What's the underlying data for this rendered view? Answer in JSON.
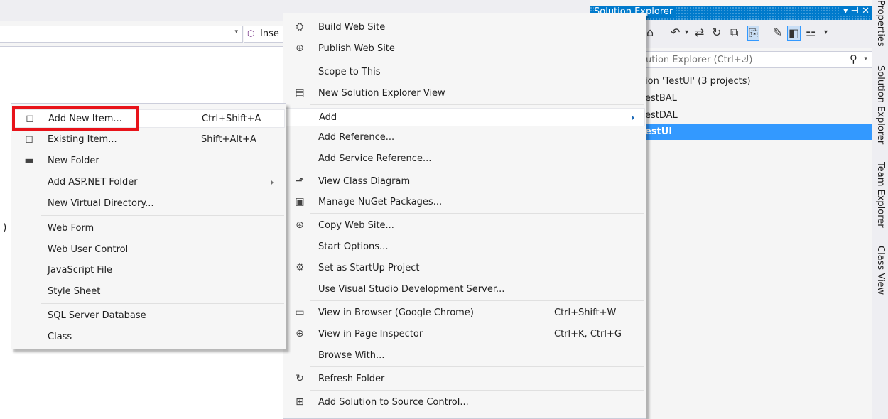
{
  "editor": {
    "navigation_combo_arrow": "▾",
    "member_combo_icon": "⬡",
    "member_combo_text": "Inse",
    "paren_glyph": ")"
  },
  "solution_explorer": {
    "title": "Solution Explorer",
    "title_controls": "▾ ⊣ ✕",
    "search_placeholder": "ution Explorer (Ctrl+ك)",
    "search_icon": "⚲",
    "tree": [
      {
        "label": "ion 'TestUI' (3 projects)",
        "selected": false
      },
      {
        "label": "estBAL",
        "selected": false
      },
      {
        "label": "estDAL",
        "selected": false
      },
      {
        "label": "estUI",
        "selected": true
      }
    ]
  },
  "side_tabs": [
    "Properties",
    "Solution Explorer",
    "Team Explorer",
    "Class View"
  ],
  "main_menu": {
    "items": [
      {
        "label": "Build Web Site",
        "icon": "build-icon"
      },
      {
        "label": "Publish Web Site",
        "icon": "publish-icon"
      },
      {
        "label": "Scope to This",
        "icon": ""
      },
      {
        "label": "New Solution Explorer View",
        "icon": "new-view-icon"
      },
      {
        "label": "Add",
        "icon": "",
        "submenu": true
      },
      {
        "label": "Add Reference...",
        "icon": ""
      },
      {
        "label": "Add Service Reference...",
        "icon": ""
      },
      {
        "label": "View Class Diagram",
        "icon": "class-diagram-icon"
      },
      {
        "label": "Manage NuGet Packages...",
        "icon": "nuget-icon"
      },
      {
        "label": "Copy Web Site...",
        "icon": "copy-web-icon"
      },
      {
        "label": "Start Options...",
        "icon": ""
      },
      {
        "label": "Set as StartUp Project",
        "icon": "gear-icon"
      },
      {
        "label": "Use Visual Studio Development Server...",
        "icon": ""
      },
      {
        "label": "View in Browser (Google Chrome)",
        "icon": "browser-icon",
        "shortcut": "Ctrl+Shift+W"
      },
      {
        "label": "View in Page Inspector",
        "icon": "page-inspector-icon",
        "shortcut": "Ctrl+K, Ctrl+G"
      },
      {
        "label": "Browse With...",
        "icon": ""
      },
      {
        "label": "Refresh Folder",
        "icon": "refresh-icon"
      },
      {
        "label": "Add Solution to Source Control...",
        "icon": "source-control-icon"
      }
    ]
  },
  "add_submenu": {
    "items": [
      {
        "label": "Add New Item...",
        "shortcut": "Ctrl+Shift+A",
        "icon": "new-item-icon"
      },
      {
        "label": "Existing Item...",
        "shortcut": "Shift+Alt+A",
        "icon": "existing-item-icon"
      },
      {
        "label": "New Folder",
        "icon": "new-folder-icon"
      },
      {
        "label": "Add ASP.NET Folder",
        "submenu": true
      },
      {
        "label": "New Virtual Directory..."
      },
      {
        "label": "Web Form"
      },
      {
        "label": "Web User Control"
      },
      {
        "label": "JavaScript File"
      },
      {
        "label": "Style Sheet"
      },
      {
        "label": "SQL Server Database"
      },
      {
        "label": "Class"
      }
    ]
  },
  "colors": {
    "accent": "#007acc",
    "selection": "#3399ff",
    "annotation_border": "#e8131a"
  }
}
